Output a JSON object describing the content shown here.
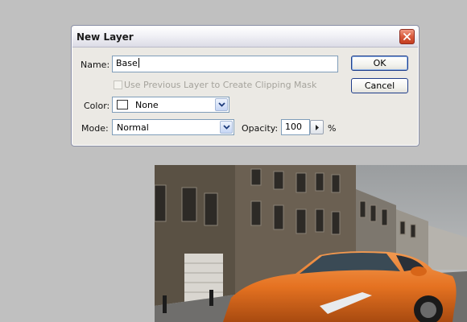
{
  "dialog": {
    "title": "New Layer",
    "name_label": "Name:",
    "name_value": "Base",
    "clip_mask_label": "Use Previous Layer to Create Clipping Mask",
    "clip_mask_checked": false,
    "clip_mask_enabled": false,
    "color_label": "Color:",
    "color_value": "None",
    "mode_label": "Mode:",
    "mode_value": "Normal",
    "opacity_label": "Opacity:",
    "opacity_value": "100",
    "opacity_unit": "%",
    "ok_label": "OK",
    "cancel_label": "Cancel",
    "close_icon": "close-icon"
  },
  "colors": {
    "background": "#c0c0c0",
    "dialog_bg": "#ebe9e4",
    "close_button": "#d95b3d",
    "button_border": "#1f3d8a"
  }
}
